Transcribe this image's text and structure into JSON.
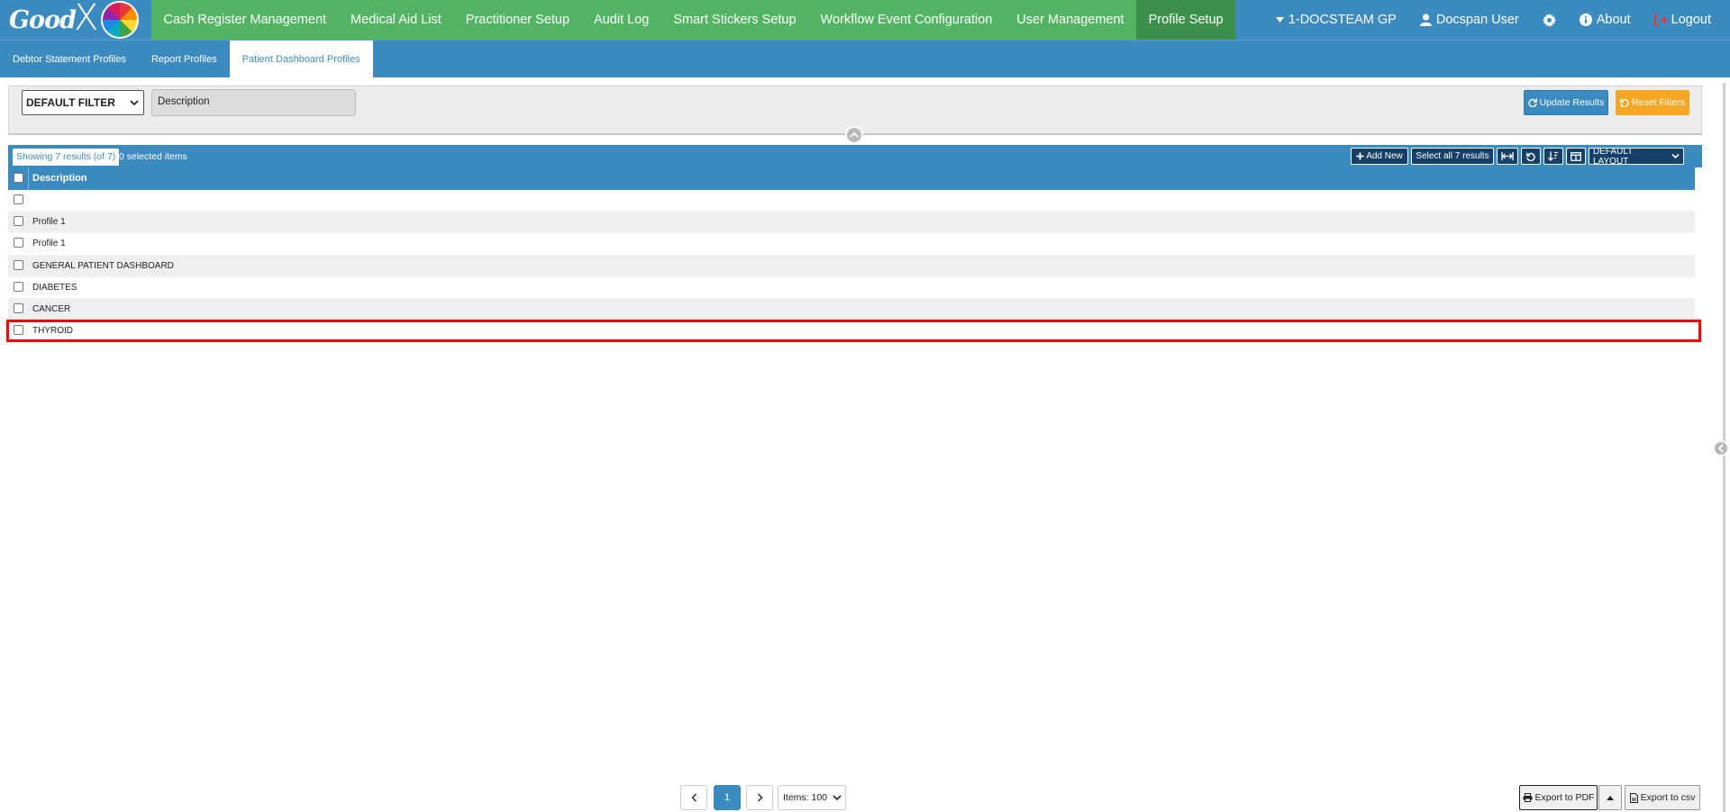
{
  "brand": {
    "logo_text": "Good",
    "logo_x": "X"
  },
  "nav": {
    "items": [
      {
        "label": "Cash Register Management"
      },
      {
        "label": "Medical Aid List"
      },
      {
        "label": "Practitioner Setup"
      },
      {
        "label": "Audit Log"
      },
      {
        "label": "Smart Stickers Setup"
      },
      {
        "label": "Workflow Event Configuration"
      },
      {
        "label": "User Management"
      },
      {
        "label": "Profile Setup",
        "active": true
      }
    ],
    "practice": "1-DOCSTEAM GP",
    "user": "Docspan User",
    "about": "About",
    "logout": "Logout"
  },
  "subtabs": [
    {
      "label": "Debtor Statement Profiles"
    },
    {
      "label": "Report Profiles"
    },
    {
      "label": "Patient Dashboard Profiles",
      "active": true
    }
  ],
  "filter": {
    "select_value": "DEFAULT FILTER",
    "description_label": "Description",
    "update_label": "Update Results",
    "reset_label": "Reset Filters"
  },
  "grid": {
    "showing": "Showing 7 results (of 7)",
    "selected": "0 selected items",
    "add_new": "Add New",
    "select_all": "Select all 7 results",
    "layout": "DEFAULT LAYOUT",
    "columns": [
      "Description"
    ],
    "rows": [
      {
        "description": ""
      },
      {
        "description": "Profile 1"
      },
      {
        "description": "Profile 1"
      },
      {
        "description": "GENERAL PATIENT DASHBOARD"
      },
      {
        "description": "DIABETES"
      },
      {
        "description": "CANCER"
      },
      {
        "description": "THYROID"
      }
    ]
  },
  "pagination": {
    "current_page": "1",
    "items_label": "Items: 100"
  },
  "export": {
    "pdf_label": "Export to PDF",
    "csv_label": "Export to csv"
  },
  "colors": {
    "primary": "#3c8bc0",
    "nav_green": "#53b563",
    "nav_active": "#3d8f4c",
    "reset_orange": "#f5a623",
    "highlight": "#ff0000"
  }
}
